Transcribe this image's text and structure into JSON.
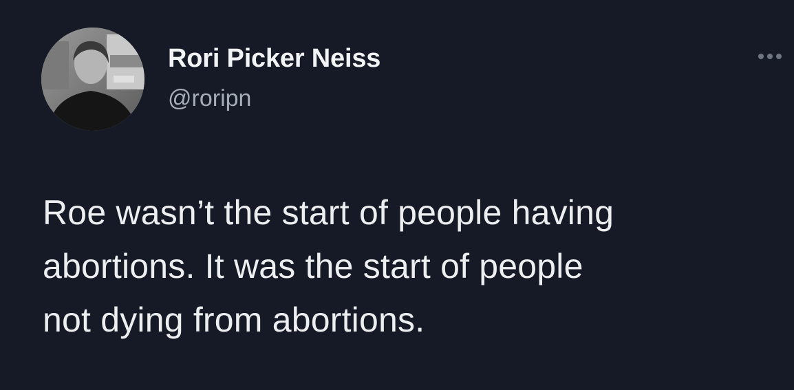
{
  "tweet": {
    "author": {
      "display_name": "Rori Picker Neiss",
      "handle": "@roripn",
      "avatar_icon": "profile-photo"
    },
    "more_icon": "more-options-icon",
    "text": "Roe wasn’t the start of people having\nabortions. It was the start of people\nnot dying from abortions."
  },
  "colors": {
    "background": "#161a26",
    "text_primary": "#eceef0",
    "text_secondary": "#a6adb6"
  }
}
